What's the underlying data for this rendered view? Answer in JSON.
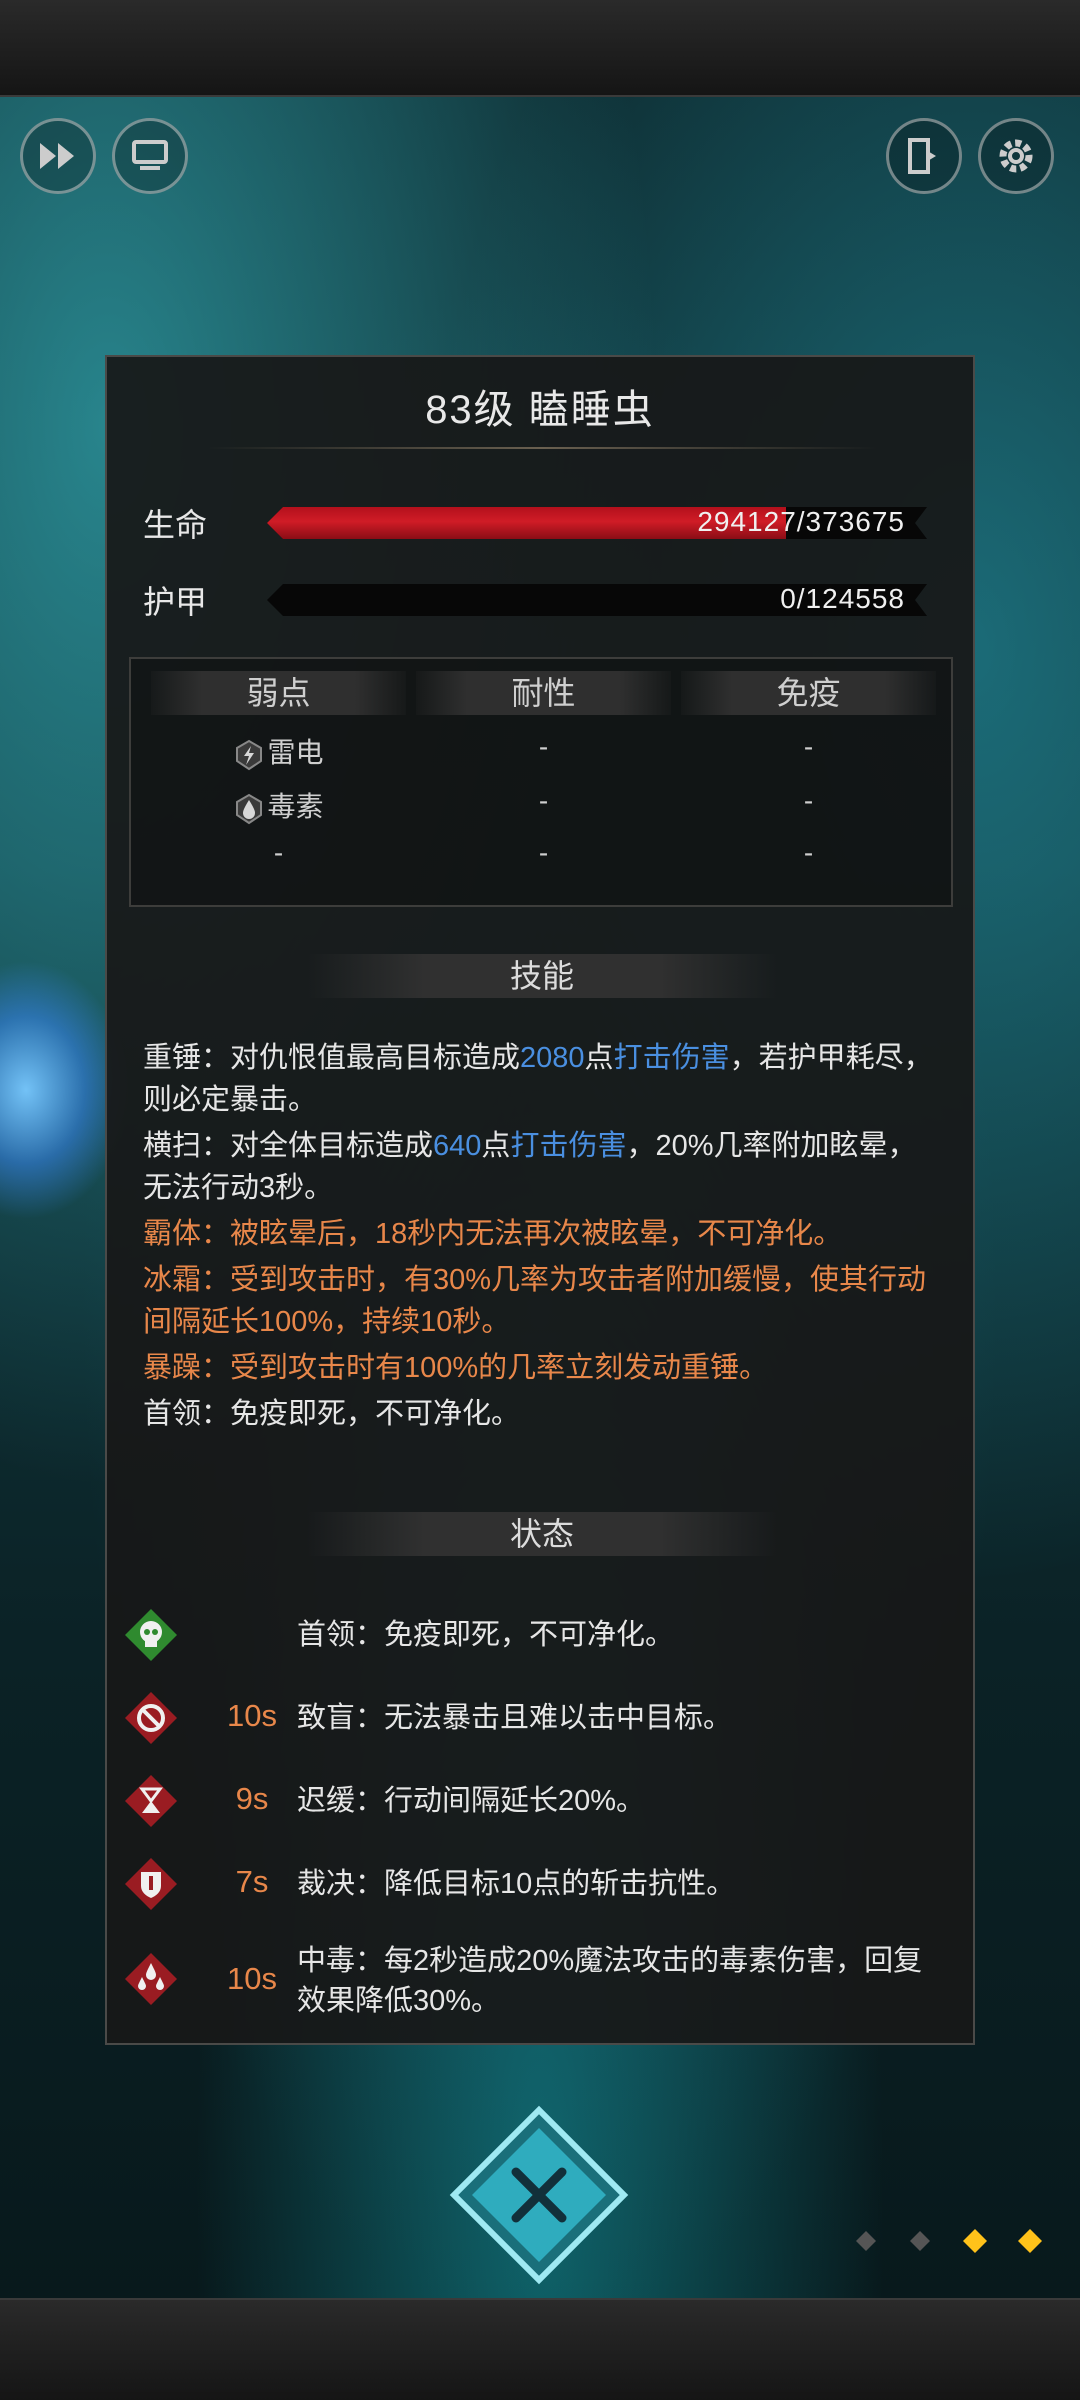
{
  "enemy": {
    "title": "83级  瞌睡虫"
  },
  "stats": {
    "hp_label": "生命",
    "hp_text": "294127/373675",
    "hp_fraction": 0.787,
    "armor_label": "护甲",
    "armor_text": "0/124558",
    "armor_fraction": 0
  },
  "resistance": {
    "headers": [
      "弱点",
      "耐性",
      "免疫"
    ],
    "rows": [
      [
        "雷电",
        "-",
        "-"
      ],
      [
        "毒素",
        "-",
        "-"
      ],
      [
        "-",
        "-",
        "-"
      ]
    ]
  },
  "skills": {
    "header": "技能",
    "s1_name": "重锤：",
    "s1_a": "对仇恨值最高目标造成",
    "s1_num": "2080",
    "s1_b": "点",
    "s1_type": "打击伤害",
    "s1_c": "，若护甲耗尽，则必定暴击。",
    "s2_name": "横扫：",
    "s2_a": "对全体目标造成",
    "s2_num": "640",
    "s2_b": "点",
    "s2_type": "打击伤害",
    "s2_c": "，20%几率附加眩晕，无法行动3秒。",
    "s3": "霸体：被眩晕后，18秒内无法再次被眩晕，不可净化。",
    "s4": "冰霜：受到攻击时，有30%几率为攻击者附加缓慢，使其行动间隔延长100%，持续10秒。",
    "s5": "暴躁：受到攻击时有100%的几率立刻发动重锤。",
    "s6": "首领：免疫即死，不可净化。"
  },
  "status": {
    "header": "状态",
    "items": [
      {
        "icon": "skull-icon",
        "time": "",
        "text": "首领：免疫即死，不可净化。"
      },
      {
        "icon": "blind-icon",
        "time": "10s",
        "text": "致盲：无法暴击且难以击中目标。"
      },
      {
        "icon": "hourglass-icon",
        "time": "9s",
        "text": "迟缓：行动间隔延长20%。"
      },
      {
        "icon": "shield-icon",
        "time": "7s",
        "text": "裁决：降低目标10点的斩击抗性。"
      },
      {
        "icon": "poison-drops-icon",
        "time": "10s",
        "text": "中毒：每2秒造成20%魔法攻击的毒素伤害，回复效果降低30%。"
      }
    ]
  },
  "colors": {
    "orange": "#e8874a",
    "blue": "#4a8fe0",
    "hp": "#c81a24"
  }
}
